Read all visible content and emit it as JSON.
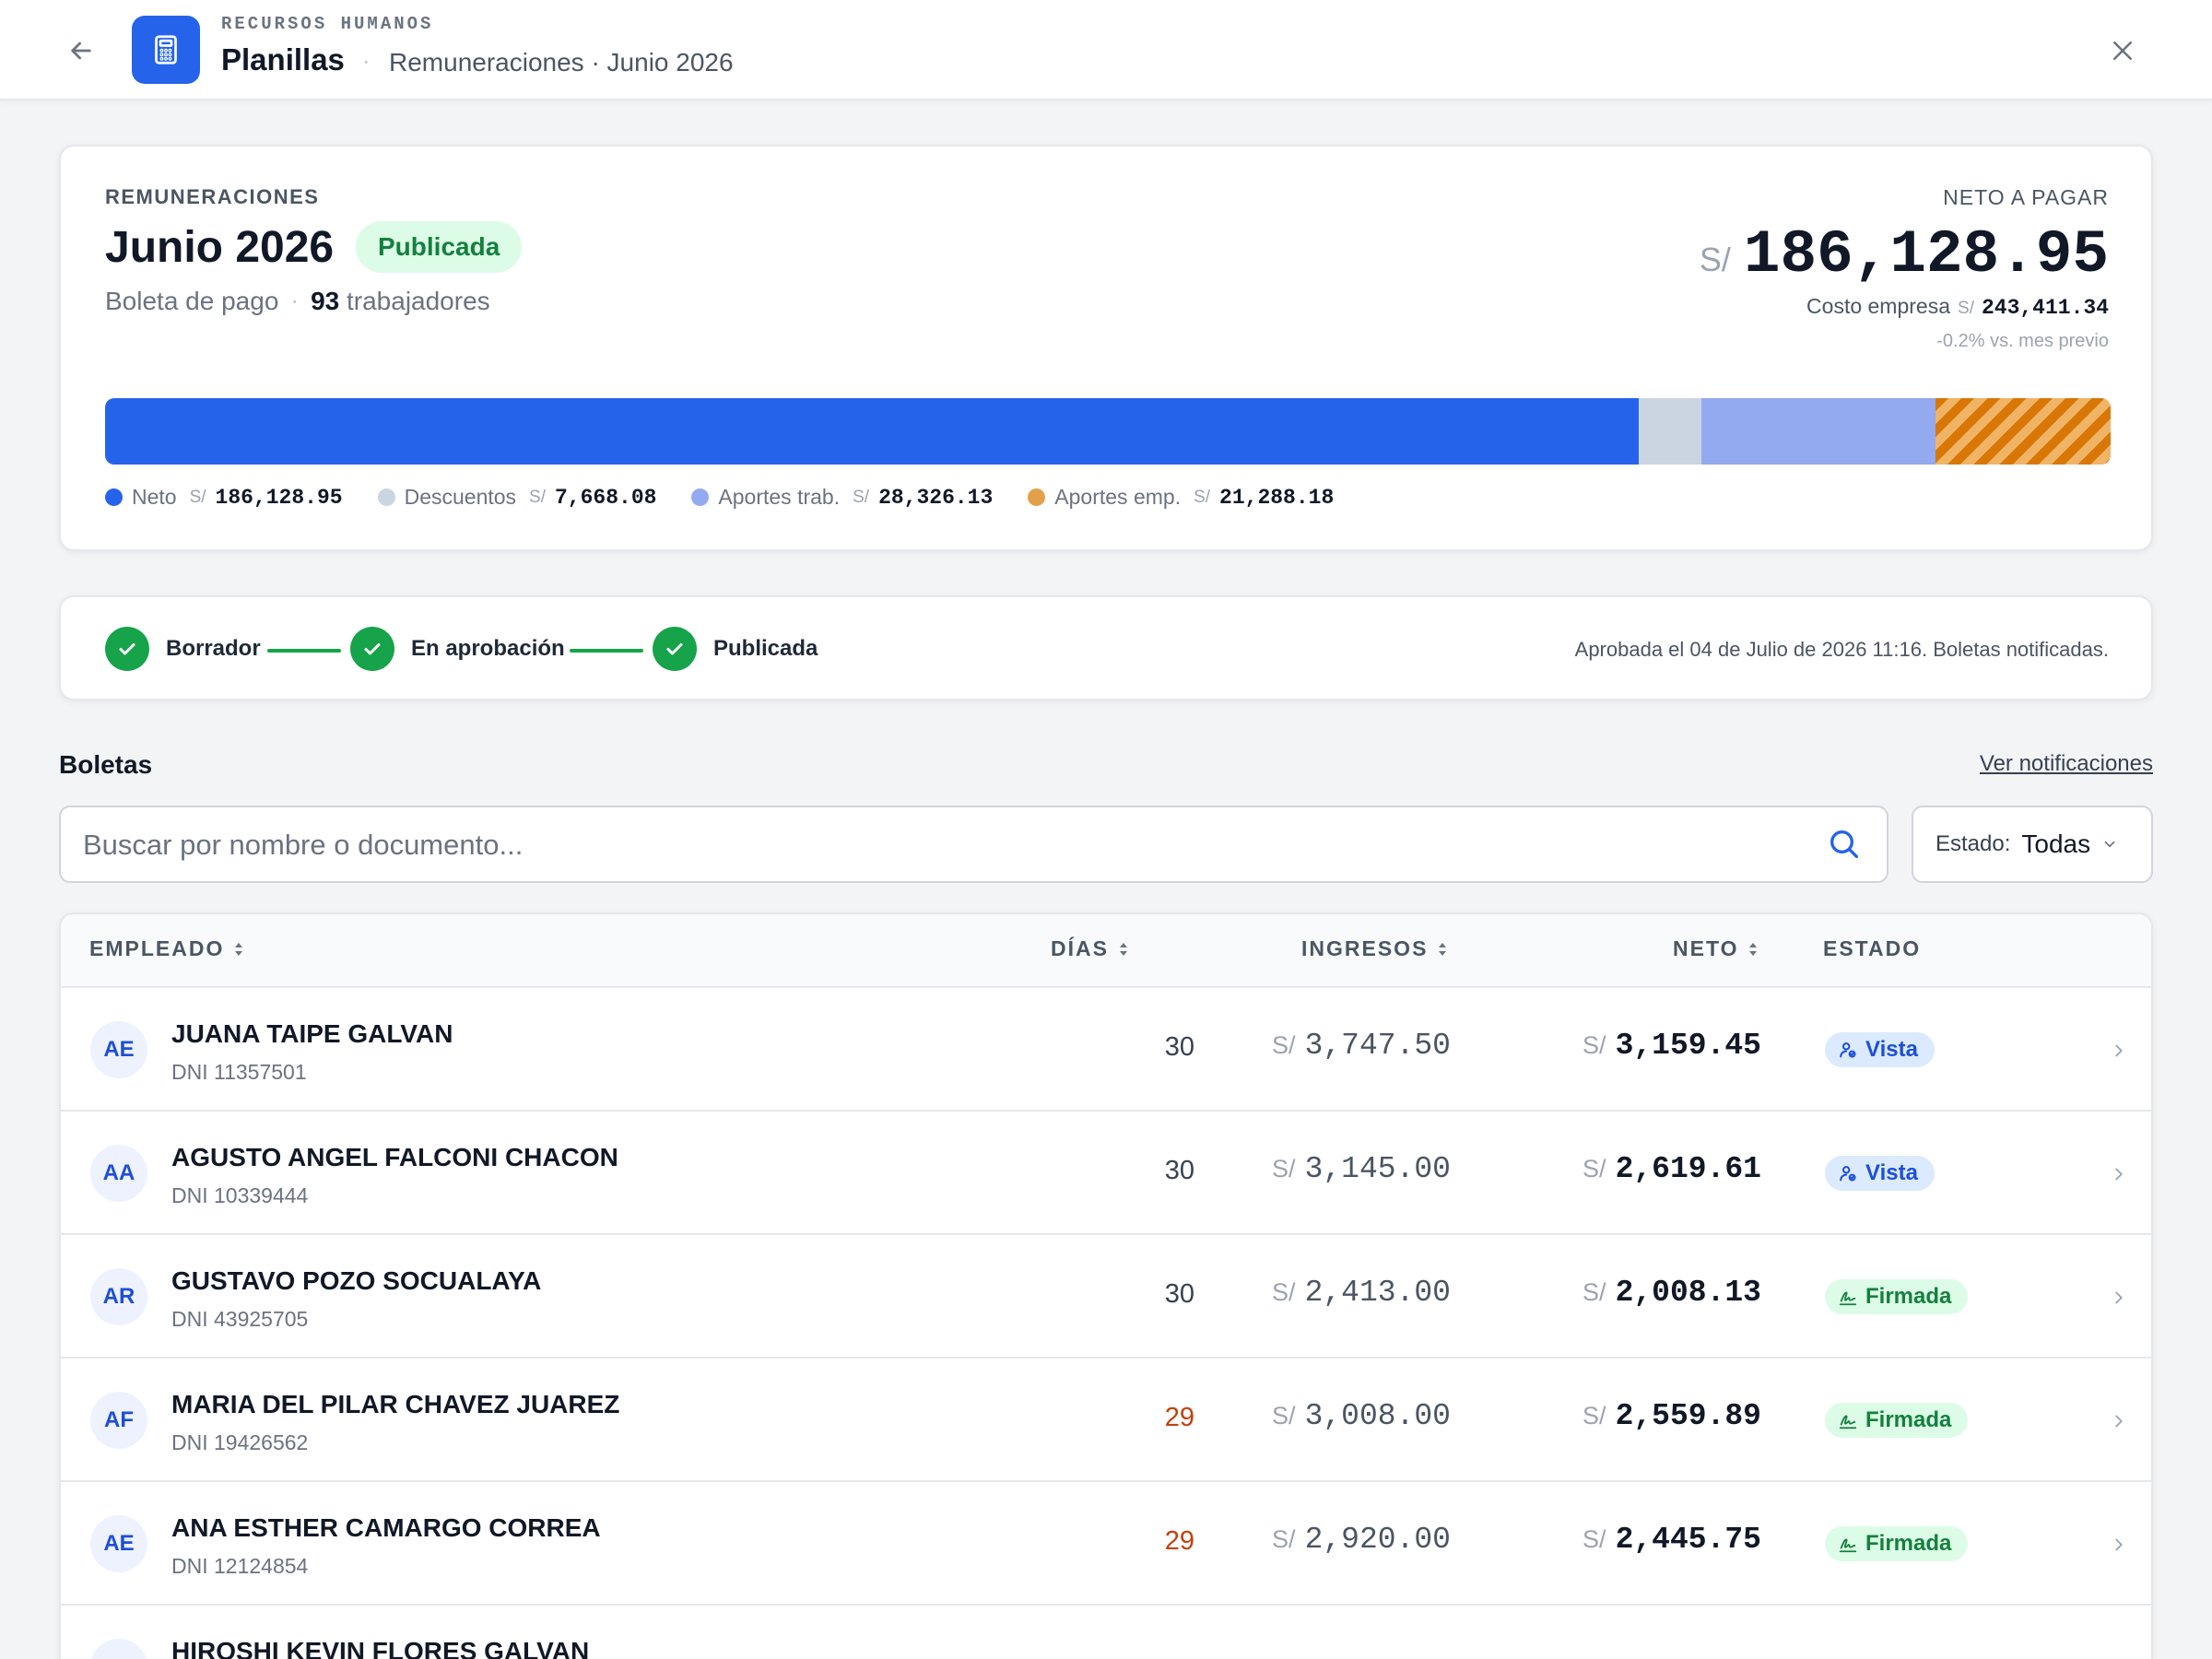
{
  "header": {
    "eyebrow": "RECURSOS HUMANOS",
    "title": "Planillas",
    "crumb": "Remuneraciones · Junio 2026"
  },
  "summary": {
    "eyebrow": "REMUNERACIONES",
    "title": "Junio 2026",
    "status": "Publicada",
    "doc_type": "Boleta de pago",
    "workers_count": "93",
    "workers_label": "trabajadores",
    "neto_label": "NETO A PAGAR",
    "currency": "S/",
    "neto_value": "186,128.95",
    "costo_label": "Costo empresa",
    "costo_value": "243,411.34",
    "delta": "-0.2% vs. mes previo",
    "breakdown": [
      {
        "key": "neto",
        "label": "Neto",
        "value": "186,128.95",
        "amount": 186128.95,
        "color": "#2563eb"
      },
      {
        "key": "descuentos",
        "label": "Descuentos",
        "value": "7,668.08",
        "amount": 7668.08,
        "color": "#cbd5e1"
      },
      {
        "key": "aportes_trab",
        "label": "Aportes trab.",
        "value": "28,326.13",
        "amount": 28326.13,
        "color": "#93a9f0"
      },
      {
        "key": "aportes_emp",
        "label": "Aportes emp.",
        "value": "21,288.18",
        "amount": 21288.18,
        "color": "#d97706"
      }
    ]
  },
  "stepper": {
    "steps": [
      "Borrador",
      "En aprobación",
      "Publicada"
    ],
    "note": "Aprobada el 04 de Julio de 2026 11:16. Boletas notificadas."
  },
  "boletas": {
    "title": "Boletas",
    "notif_link": "Ver notificaciones",
    "search_placeholder": "Buscar por nombre o documento...",
    "filter_label": "Estado:",
    "filter_value": "Todas",
    "columns": {
      "empleado": "EMPLEADO",
      "dias": "DÍAS",
      "ingresos": "INGRESOS",
      "neto": "NETO",
      "estado": "ESTADO"
    },
    "rows": [
      {
        "initials": "AE",
        "name": "JUANA TAIPE GALVAN",
        "doc": "DNI 11357501",
        "dias": "30",
        "ingresos": "3,747.50",
        "neto": "3,159.45",
        "estado": "Vista"
      },
      {
        "initials": "AA",
        "name": "AGUSTO ANGEL FALCONI CHACON",
        "doc": "DNI 10339444",
        "dias": "30",
        "ingresos": "3,145.00",
        "neto": "2,619.61",
        "estado": "Vista"
      },
      {
        "initials": "AR",
        "name": "GUSTAVO POZO SOCUALAYA",
        "doc": "DNI 43925705",
        "dias": "30",
        "ingresos": "2,413.00",
        "neto": "2,008.13",
        "estado": "Firmada"
      },
      {
        "initials": "AF",
        "name": "MARIA DEL PILAR CHAVEZ JUAREZ",
        "doc": "DNI 19426562",
        "dias": "29",
        "ingresos": "3,008.00",
        "neto": "2,559.89",
        "estado": "Firmada"
      },
      {
        "initials": "AE",
        "name": "ANA ESTHER CAMARGO CORREA",
        "doc": "DNI 12124854",
        "dias": "29",
        "ingresos": "2,920.00",
        "neto": "2,445.75",
        "estado": "Firmada"
      },
      {
        "initials": "",
        "name": "HIROSHI KEVIN FLORES GALVAN",
        "doc": "",
        "dias": "",
        "ingresos": "",
        "neto": "",
        "estado": ""
      }
    ]
  }
}
